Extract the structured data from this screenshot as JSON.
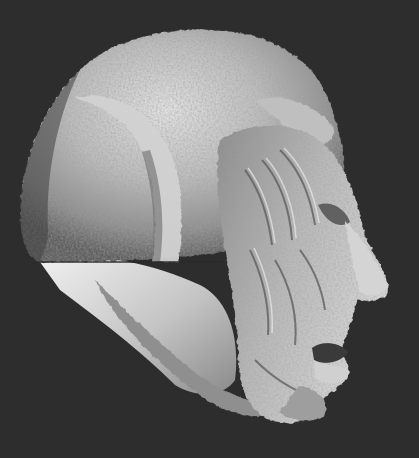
{
  "viewport": {
    "background_color": "#2d2d2d",
    "model_color": "#a9a9a9",
    "highlight_color": "#e6e6e6",
    "shadow_color": "#4a4a4a",
    "subject": "sculpted-head-mesh"
  }
}
